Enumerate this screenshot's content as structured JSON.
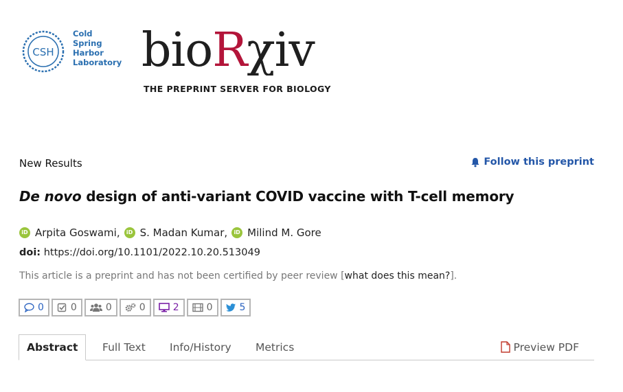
{
  "header": {
    "csh_monogram": "CSH",
    "csh_lines": [
      "Cold",
      "Spring",
      "Harbor",
      "Laboratory"
    ],
    "logo_bio": "bio",
    "logo_r": "R",
    "logo_xiv": "χiv",
    "tagline": "THE PREPRINT SERVER FOR BIOLOGY"
  },
  "article": {
    "type": "New Results",
    "follow_label": "Follow this preprint",
    "title_italic": "De novo",
    "title_rest": " design of anti-variant COVID vaccine with T-cell memory",
    "authors": [
      {
        "name": "Arpita Goswami",
        "sep": ","
      },
      {
        "name": "S. Madan Kumar",
        "sep": ","
      },
      {
        "name": "Milind M. Gore",
        "sep": ""
      }
    ],
    "orcid_label": "iD",
    "doi_label": "doi:",
    "doi_value": "https://doi.org/10.1101/2022.10.20.513049",
    "disclaimer_text": "This article is a preprint and has not been certified by peer review [",
    "disclaimer_link": "what does this mean?",
    "disclaimer_end": "]."
  },
  "counters": [
    {
      "icon": "comment-icon",
      "value": "0"
    },
    {
      "icon": "check-square-icon",
      "value": "0"
    },
    {
      "icon": "users-icon",
      "value": "0"
    },
    {
      "icon": "gears-icon",
      "value": "0"
    },
    {
      "icon": "monitor-icon",
      "value": "2"
    },
    {
      "icon": "film-icon",
      "value": "0"
    },
    {
      "icon": "twitter-icon",
      "value": "5"
    }
  ],
  "tabs": {
    "abstract": "Abstract",
    "full_text": "Full Text",
    "info_history": "Info/History",
    "metrics": "Metrics",
    "preview_pdf": "Preview PDF"
  },
  "colors": {
    "link_blue": "#2457a8",
    "orcid_green": "#9ac53c",
    "biorxiv_red": "#b3153a",
    "csh_blue": "#2a6fb0"
  }
}
